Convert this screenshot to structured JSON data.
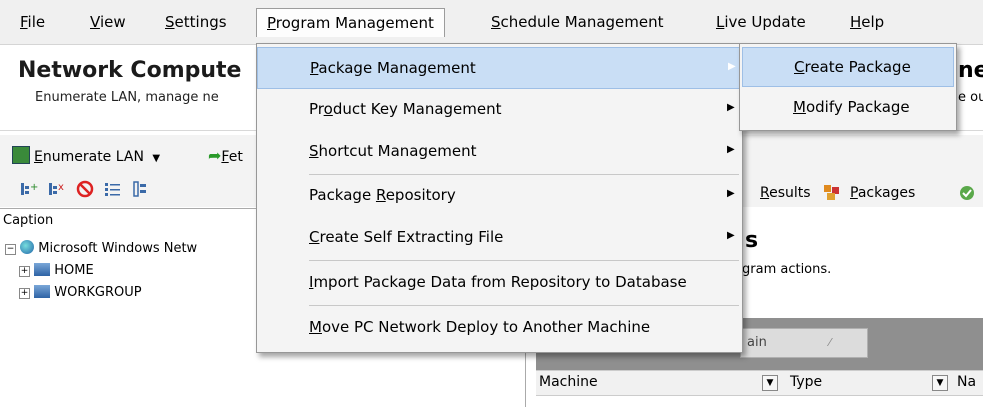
{
  "menubar": {
    "items": [
      {
        "label": "File",
        "ul": "F",
        "rest": "ile"
      },
      {
        "label": "View",
        "ul": "V",
        "rest": "iew"
      },
      {
        "label": "Settings",
        "ul": "S",
        "rest": "ettings"
      },
      {
        "label": "Program Management",
        "ul": "P",
        "rest": "rogram Management"
      },
      {
        "label": "Schedule Management",
        "ul": "S",
        "rest": "chedule Management"
      },
      {
        "label": "Live Update",
        "ul": "L",
        "rest": "ive Update"
      },
      {
        "label": "Help",
        "ul": "H",
        "rest": "elp"
      }
    ]
  },
  "header": {
    "title": "Network Compute",
    "subtitle": "Enumerate LAN, manage ne",
    "right_title": "ne",
    "right_subtitle": "e ou"
  },
  "toolbar": {
    "enumerate_ul": "E",
    "enumerate_rest": "numerate LAN",
    "fetch_ul": "F",
    "fetch_rest": "et"
  },
  "tree": {
    "caption": "Caption",
    "root": "Microsoft Windows Netw",
    "children": [
      "HOME",
      "WORKGROUP"
    ]
  },
  "tabs": {
    "results_ul": "R",
    "results_rest": "esults",
    "packages_ul": "P",
    "packages_rest": "ackages"
  },
  "right_panel": {
    "title_fragment": "s",
    "desc_fragment": "gram actions.",
    "group_chip": "ain",
    "columns": [
      "Machine",
      "Type",
      "Na"
    ]
  },
  "dropdown": {
    "items": [
      {
        "pre": "",
        "ul": "P",
        "post": "ackage Management",
        "arrow": true
      },
      {
        "pre": "Pr",
        "ul": "o",
        "post": "duct Key Management",
        "arrow": true
      },
      {
        "pre": "",
        "ul": "S",
        "post": "hortcut Management",
        "arrow": true
      },
      {
        "pre": "Package ",
        "ul": "R",
        "post": "epository",
        "arrow": true
      },
      {
        "pre": "",
        "ul": "C",
        "post": "reate Self Extracting File",
        "arrow": true
      },
      {
        "pre": "",
        "ul": "I",
        "post": "mport Package Data from Repository to Database",
        "arrow": false
      },
      {
        "pre": "",
        "ul": "M",
        "post": "ove PC Network Deploy to Another Machine",
        "arrow": false
      }
    ]
  },
  "submenu": {
    "items": [
      {
        "ul": "C",
        "post": "reate Package"
      },
      {
        "ul": "M",
        "post": "odify Package"
      }
    ]
  },
  "colors": {
    "menu_bg": "#f4f4f4",
    "hover_bg": "#c9def5",
    "hover_border": "#9ebfe6",
    "grouping_bg": "#8f8f8f"
  }
}
